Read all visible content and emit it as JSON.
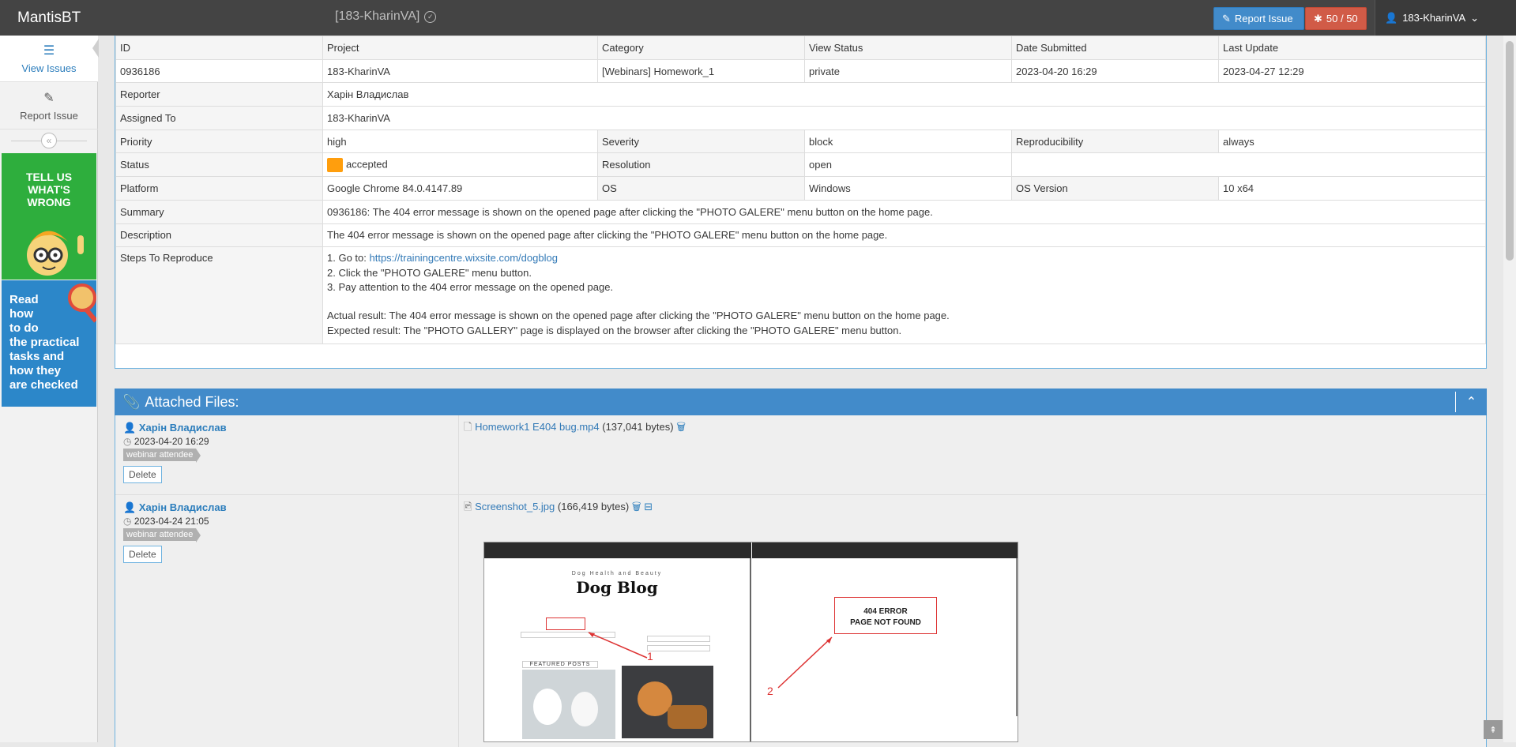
{
  "app": {
    "brand": "MantisBT",
    "project_selector": "[183-KharinVA]",
    "report_issue_label": "Report Issue",
    "issue_count": "50 / 50",
    "user_label": "183-KharinVA"
  },
  "sidebar": {
    "items": [
      {
        "label": "View Issues",
        "icon": "list-icon"
      },
      {
        "label": "Report Issue",
        "icon": "edit-icon"
      }
    ],
    "promo_green": [
      "TELL US",
      "WHAT'S",
      "WRONG"
    ],
    "promo_blue": [
      "Read",
      "how",
      "to do",
      "the practical",
      "tasks and",
      "how they",
      "are checked"
    ]
  },
  "issue": {
    "headers": [
      "ID",
      "Project",
      "Category",
      "View Status",
      "Date Submitted",
      "Last Update"
    ],
    "values": [
      "0936186",
      "183-KharinVA",
      "[Webinars] Homework_1",
      "private",
      "2023-04-20 16:29",
      "2023-04-27 12:29"
    ],
    "reporter_label": "Reporter",
    "reporter": "Харін Владислав",
    "assigned_label": "Assigned To",
    "assigned": "183-KharinVA",
    "priority_label": "Priority",
    "priority": "high",
    "severity_label": "Severity",
    "severity": "block",
    "reproducibility_label": "Reproducibility",
    "reproducibility": "always",
    "status_label": "Status",
    "status": "accepted",
    "status_color": "#ff9e0d",
    "resolution_label": "Resolution",
    "resolution": "open",
    "platform_label": "Platform",
    "platform": "Google Chrome 84.0.4147.89",
    "os_label": "OS",
    "os": "Windows",
    "os_version_label": "OS Version",
    "os_version": "10 x64",
    "summary_label": "Summary",
    "summary": "0936186: The 404 error message is shown on the opened page after clicking the \"PHOTO GALERE\" menu button on the home page.",
    "description_label": "Description",
    "description": "The 404 error message is shown on the opened page after clicking the \"PHOTO GALERE\" menu button on the home page.",
    "steps_label": "Steps To Reproduce",
    "steps": {
      "line1_prefix": "1. Go to: ",
      "line1_link": "https://trainingcentre.wixsite.com/dogblog",
      "line2": "2. Click the \"PHOTO GALERE\" menu button.",
      "line3": "3. Pay attention to the 404 error message on the opened page.",
      "actual": "Actual result: The 404 error message is shown on the opened page after clicking the \"PHOTO GALERE\" menu button on the home page.",
      "expected": "Expected result: The \"PHOTO GALLERY\" page is displayed on the browser after clicking the \"PHOTO GALERE\" menu button."
    }
  },
  "attachments": {
    "title": "Attached Files:",
    "files": [
      {
        "author": "Харін Владислав",
        "date": "2023-04-20 16:29",
        "role": "webinar attendee",
        "delete_label": "Delete",
        "filename": "Homework1 E404 bug.mp4",
        "size": "(137,041 bytes)"
      },
      {
        "author": "Харін Владислав",
        "date": "2023-04-24 21:05",
        "role": "webinar attendee",
        "delete_label": "Delete",
        "filename": "Screenshot_5.jpg",
        "size": "(166,419 bytes)"
      }
    ],
    "preview": {
      "tagline": "Dog Health and Beauty",
      "blog_title": "Dog Blog",
      "featured": "FEATURED POSTS",
      "error_line1": "404 ERROR",
      "error_line2": "PAGE NOT FOUND",
      "marker1": "1",
      "marker2": "2"
    }
  }
}
